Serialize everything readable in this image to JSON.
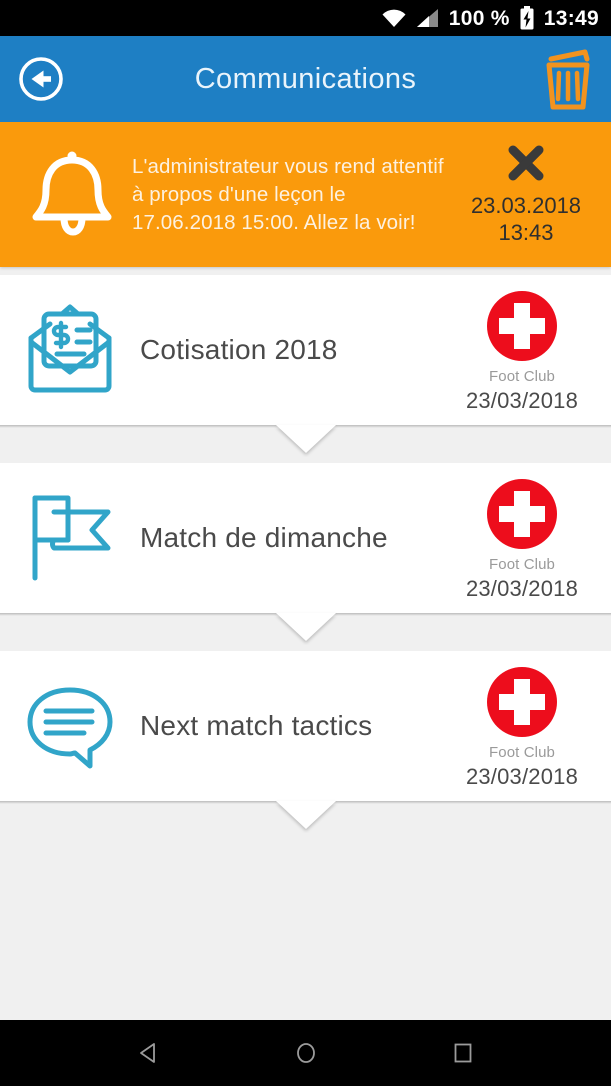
{
  "colors": {
    "app_bar_blue": "#1e7fc4",
    "banner_orange": "#fa9a0c",
    "icon_cyan": "#31a5c9",
    "logo_red": "#ed0d1c",
    "status_bar_black": "#000000",
    "page_bg": "#f0f0f0",
    "card_white": "#ffffff"
  },
  "status_bar": {
    "wifi_icon": "wifi-icon",
    "signal_icon": "cellular-signal-icon",
    "battery_percent": "100 %",
    "battery_icon": "battery-charging-icon",
    "clock": "13:49"
  },
  "app_bar": {
    "back_icon": "back-arrow-circle-icon",
    "title": "Communications",
    "delete_icon": "trash-icon"
  },
  "notification": {
    "bell_icon": "bell-icon",
    "message": "L'administrateur vous rend attentif à propos d'une leçon le 17.06.2018 15:00. Allez la voir!",
    "close_icon": "close-x-icon",
    "date": "23.03.2018",
    "time": "13:43"
  },
  "messages": [
    {
      "icon": "invoice-envelope-icon",
      "title": "Cotisation 2018",
      "club_logo": "swiss-cross-logo",
      "club_name": "Foot Club",
      "date": "23/03/2018"
    },
    {
      "icon": "flag-icon",
      "title": "Match de dimanche",
      "club_logo": "swiss-cross-logo",
      "club_name": "Foot Club",
      "date": "23/03/2018"
    },
    {
      "icon": "speech-bubble-icon",
      "title": "Next match tactics",
      "club_logo": "swiss-cross-logo",
      "club_name": "Foot Club",
      "date": "23/03/2018"
    }
  ],
  "nav_bar": {
    "back_icon": "android-back-icon",
    "home_icon": "android-home-icon",
    "recents_icon": "android-recents-icon"
  }
}
